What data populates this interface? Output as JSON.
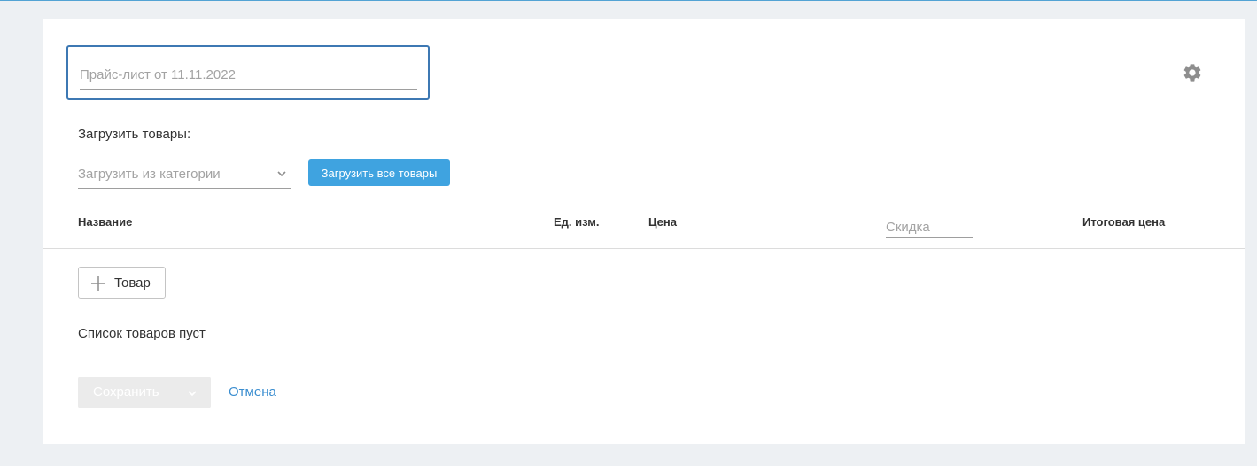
{
  "form": {
    "title_placeholder": "Прайс-лист от 11.11.2022",
    "title_value": ""
  },
  "load": {
    "label": "Загрузить товары:",
    "category_placeholder": "Загрузить из категории",
    "load_all_label": "Загрузить все товары"
  },
  "table": {
    "columns": {
      "name": "Название",
      "unit": "Ед. изм.",
      "price": "Цена",
      "discount_placeholder": "Скидка",
      "total": "Итоговая цена"
    },
    "add_item_label": "Товар",
    "empty_text": "Список товаров пуст"
  },
  "actions": {
    "save_label": "Сохранить",
    "cancel_label": "Отмена"
  },
  "icons": {
    "settings": "gear-icon",
    "category_dropdown": "chevron-down-icon",
    "add": "plus-icon",
    "save_dropdown": "chevron-down-icon"
  },
  "colors": {
    "accent": "#3fa3e0",
    "focus_border": "#3d78b3",
    "link": "#3b8ed0",
    "disabled_button": "#ebebeb"
  }
}
